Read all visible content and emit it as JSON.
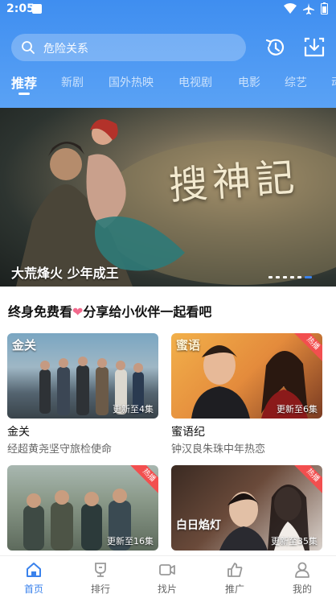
{
  "status": {
    "time": "2:05"
  },
  "search": {
    "placeholder": "危险关系"
  },
  "tabs": [
    "推荐",
    "新剧",
    "国外热映",
    "电视剧",
    "电影",
    "综艺",
    "动"
  ],
  "banner": {
    "title": "大荒烽火 少年成王",
    "logo_text": "搜神記",
    "dots": 6,
    "active_dot": 6
  },
  "section": {
    "title_left": "终身免费看",
    "title_right": "分享给小伙伴一起看吧"
  },
  "cards": [
    {
      "title": "金关",
      "subtitle": "经超黄尧坚守旅检使命",
      "update": "更新至4集",
      "logo": "金关",
      "hot": false
    },
    {
      "title": "蜜语纪",
      "subtitle": "钟汉良朱珠中年热恋",
      "update": "更新至6集",
      "logo": "蜜语",
      "hot": true,
      "hot_label": "热播"
    },
    {
      "title": "",
      "subtitle": "",
      "update": "更新至16集",
      "logo": "",
      "hot": true,
      "hot_label": "热播"
    },
    {
      "title": "",
      "subtitle": "",
      "update": "更新至35集",
      "logo": "白日焰灯",
      "hot": true,
      "hot_label": "热播"
    }
  ],
  "bottom_nav": [
    {
      "label": "首页",
      "icon": "home-icon",
      "active": true
    },
    {
      "label": "排行",
      "icon": "trophy-icon",
      "active": false
    },
    {
      "label": "找片",
      "icon": "video-icon",
      "active": false
    },
    {
      "label": "推广",
      "icon": "thumb-up-icon",
      "active": false
    },
    {
      "label": "我的",
      "icon": "user-icon",
      "active": false
    }
  ],
  "colors": {
    "accent": "#3a82ec",
    "header": "#4a95f2",
    "hot_ribbon": "#f24f4f",
    "heart": "#f26a8d"
  }
}
